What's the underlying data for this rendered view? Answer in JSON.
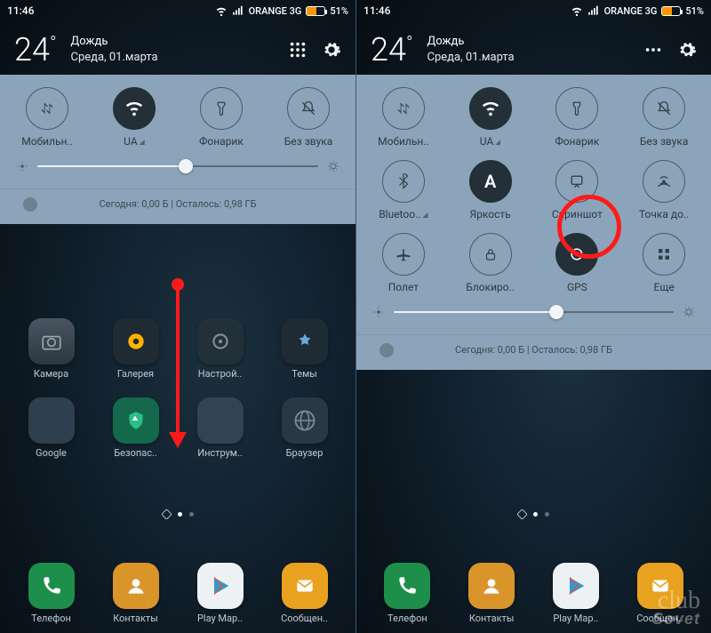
{
  "status": {
    "time": "11:46",
    "carrier": "ORANGE 3G",
    "battery_pct": "51%"
  },
  "weather": {
    "temp": "24",
    "degree": "°",
    "condition": "Дождь",
    "date": "Среда, 01.марта"
  },
  "qs": {
    "data": "Мобильн..",
    "wifi": "UA",
    "flashlight": "Фонарик",
    "mute": "Без звука",
    "bluetooth": "Bluetoo..",
    "brightness_mode": "Яркость",
    "screenshot": "Скриншот",
    "hotspot": "Точка до..",
    "airplane": "Полет",
    "lock": "Блокиро..",
    "gps": "GPS",
    "more": "Еще"
  },
  "brightness": {
    "left_pct": 53,
    "right_pct": 58
  },
  "data_usage": "Сегодня: 0,00 Б | Осталось: 0,98 ГБ",
  "apps": {
    "camera": "Камера",
    "gallery": "Галерея",
    "settings": "Настрой..",
    "themes": "Темы",
    "google": "Google",
    "security": "Безопас..",
    "tools": "Инструм..",
    "browser": "Браузер"
  },
  "dock": {
    "phone": "Телефон",
    "contacts": "Контакты",
    "play": "Play Мар..",
    "messages": "Сообщен.."
  },
  "watermark": {
    "l1": "club",
    "l2": "Sovet"
  },
  "colors": {
    "accent_red": "#ff1a1a",
    "panel_bg": "#8ca4b9",
    "active_toggle": "#233038",
    "battery_fill": "#ff9500"
  }
}
